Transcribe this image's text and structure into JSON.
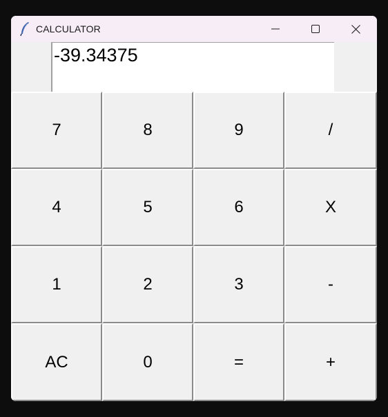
{
  "window": {
    "title": "CALCULATOR",
    "app_icon": "feather-icon",
    "controls": [
      "minimize-icon",
      "maximize-icon",
      "close-icon"
    ]
  },
  "display": {
    "value": "-39.34375"
  },
  "keys": [
    [
      "7",
      "8",
      "9",
      "/"
    ],
    [
      "4",
      "5",
      "6",
      "X"
    ],
    [
      "1",
      "2",
      "3",
      "-"
    ],
    [
      "AC",
      "0",
      "=",
      "+"
    ]
  ]
}
